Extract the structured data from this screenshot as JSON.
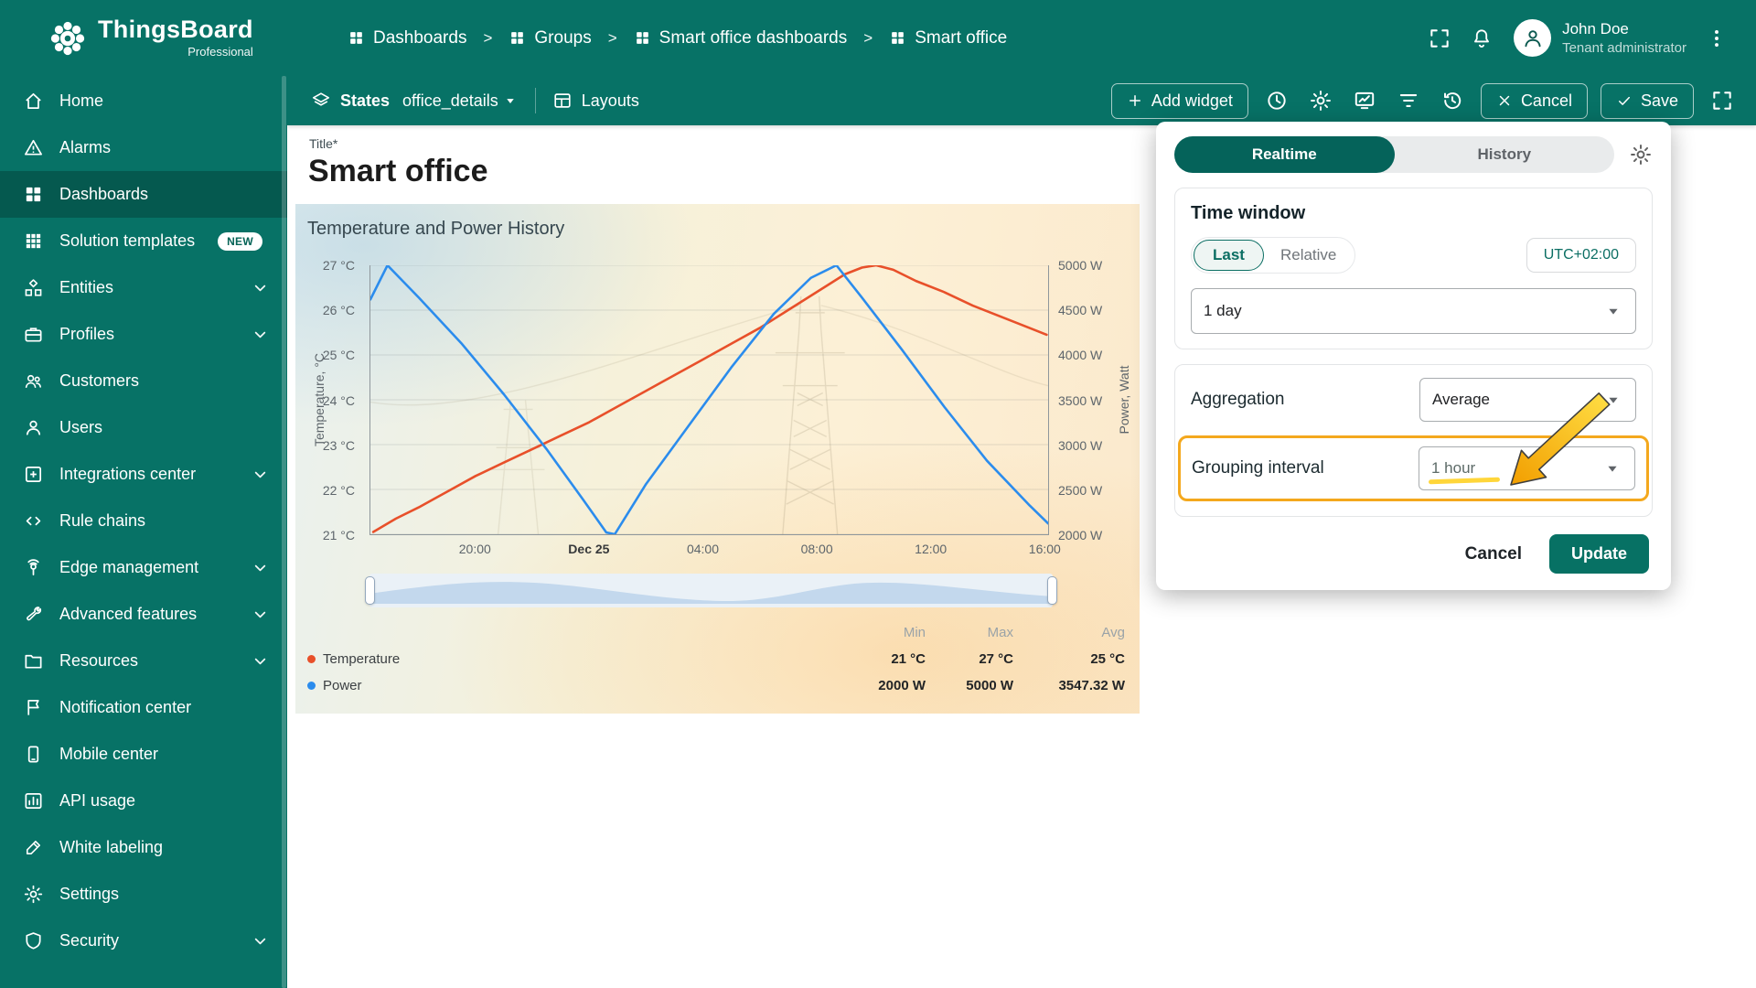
{
  "colors": {
    "teal": "#077266",
    "teal_active": "#05594f",
    "annotation_highlight": "#f4a81d",
    "temperature_series": "#e8502a",
    "power_series": "#2b8ced"
  },
  "app": {
    "name": "ThingsBoard",
    "edition": "Professional"
  },
  "header": {
    "breadcrumbs": [
      "Dashboards",
      "Groups",
      "Smart office dashboards",
      "Smart office"
    ],
    "separator": ">",
    "user_name": "John Doe",
    "user_role": "Tenant administrator"
  },
  "toolbar": {
    "states_label": "States",
    "states_value": "office_details",
    "layouts_label": "Layouts",
    "add_widget_label": "Add widget",
    "cancel_label": "Cancel",
    "save_label": "Save"
  },
  "icons": {
    "time_window": "clock-icon",
    "settings": "gear-icon",
    "notifications": "bell-icon",
    "user": "avatar-icon",
    "version_control": "history-icon",
    "filters": "filter-icon",
    "aliases": "monitor-chart-icon"
  },
  "sidebar": {
    "items": [
      {
        "label": "Home"
      },
      {
        "label": "Alarms"
      },
      {
        "label": "Dashboards"
      },
      {
        "label": "Solution templates",
        "badge": "NEW"
      },
      {
        "label": "Entities"
      },
      {
        "label": "Profiles"
      },
      {
        "label": "Customers"
      },
      {
        "label": "Users"
      },
      {
        "label": "Integrations center"
      },
      {
        "label": "Rule chains"
      },
      {
        "label": "Edge management"
      },
      {
        "label": "Advanced features"
      },
      {
        "label": "Resources"
      },
      {
        "label": "Notification center"
      },
      {
        "label": "Mobile center"
      },
      {
        "label": "API usage"
      },
      {
        "label": "White labeling"
      },
      {
        "label": "Settings"
      },
      {
        "label": "Security"
      }
    ]
  },
  "page": {
    "title_label": "Title*",
    "title": "Smart office"
  },
  "widget": {
    "title": "Temperature and Power History",
    "stats_headers": [
      "Min",
      "Max",
      "Avg"
    ],
    "series_stats": [
      {
        "name": "Temperature",
        "min": "21 °C",
        "max": "27 °C",
        "avg": "25 °C"
      },
      {
        "name": "Power",
        "min": "2000 W",
        "max": "5000 W",
        "avg": "3547.32 W"
      }
    ]
  },
  "chart_data": {
    "type": "line",
    "title": "Temperature and Power History",
    "x_axis": {
      "range_hours": [
        16.3,
        40.15
      ],
      "tick_hours": [
        20,
        24,
        28,
        32,
        36,
        40
      ],
      "ticks": [
        "20:00",
        "Dec 25",
        "04:00",
        "08:00",
        "12:00",
        "16:00"
      ]
    },
    "y_left": {
      "label": "Temperature, °C",
      "min": 21,
      "max": 27,
      "ticks": [
        "27 °C",
        "26 °C",
        "25 °C",
        "24 °C",
        "23 °C",
        "22 °C",
        "21 °C"
      ]
    },
    "y_right": {
      "label": "Power, Watt",
      "min": 2000,
      "max": 5000,
      "ticks": [
        "5000 W",
        "4500 W",
        "4000 W",
        "3500 W",
        "3000 W",
        "2500 W",
        "2000 W"
      ]
    },
    "grid": true,
    "legend_position": "bottom-left",
    "series": [
      {
        "name": "Temperature",
        "axis": "left",
        "color": "#e8502a",
        "points": [
          [
            16.4,
            21.05
          ],
          [
            17.2,
            21.35
          ],
          [
            18,
            21.6
          ],
          [
            19,
            21.95
          ],
          [
            20,
            22.3
          ],
          [
            21,
            22.6
          ],
          [
            22,
            22.9
          ],
          [
            23,
            23.2
          ],
          [
            24,
            23.5
          ],
          [
            25,
            23.85
          ],
          [
            26,
            24.2
          ],
          [
            27,
            24.55
          ],
          [
            28,
            24.9
          ],
          [
            29,
            25.25
          ],
          [
            30,
            25.6
          ],
          [
            31,
            26
          ],
          [
            32,
            26.4
          ],
          [
            33,
            26.8
          ],
          [
            33.6,
            26.95
          ],
          [
            34.1,
            27
          ],
          [
            34.7,
            26.9
          ],
          [
            35.5,
            26.65
          ],
          [
            36.5,
            26.4
          ],
          [
            37.5,
            26.1
          ],
          [
            38.5,
            25.85
          ],
          [
            39.5,
            25.6
          ],
          [
            40.1,
            25.45
          ]
        ]
      },
      {
        "name": "Power",
        "axis": "right",
        "color": "#2b8ced",
        "points": [
          [
            16.3,
            4620
          ],
          [
            16.9,
            5000
          ],
          [
            18,
            4640
          ],
          [
            19.5,
            4130
          ],
          [
            21,
            3560
          ],
          [
            22.5,
            2950
          ],
          [
            23.8,
            2380
          ],
          [
            24.6,
            2020
          ],
          [
            24.9,
            2000
          ],
          [
            26,
            2560
          ],
          [
            27.5,
            3210
          ],
          [
            29,
            3860
          ],
          [
            30.5,
            4460
          ],
          [
            31.8,
            4860
          ],
          [
            32.7,
            5000
          ],
          [
            33.6,
            4640
          ],
          [
            35,
            4060
          ],
          [
            36.5,
            3420
          ],
          [
            38,
            2820
          ],
          [
            39.5,
            2320
          ],
          [
            40.15,
            2120
          ]
        ]
      }
    ]
  },
  "popup": {
    "tabs": {
      "realtime": "Realtime",
      "history": "History"
    },
    "time_window": {
      "heading": "Time window",
      "last": "Last",
      "relative": "Relative",
      "timezone": "UTC+02:00",
      "interval_value": "1 day"
    },
    "aggregation": {
      "label": "Aggregation",
      "value": "Average"
    },
    "grouping": {
      "label": "Grouping interval",
      "value": "1 hour"
    },
    "cancel_label": "Cancel",
    "update_label": "Update"
  }
}
